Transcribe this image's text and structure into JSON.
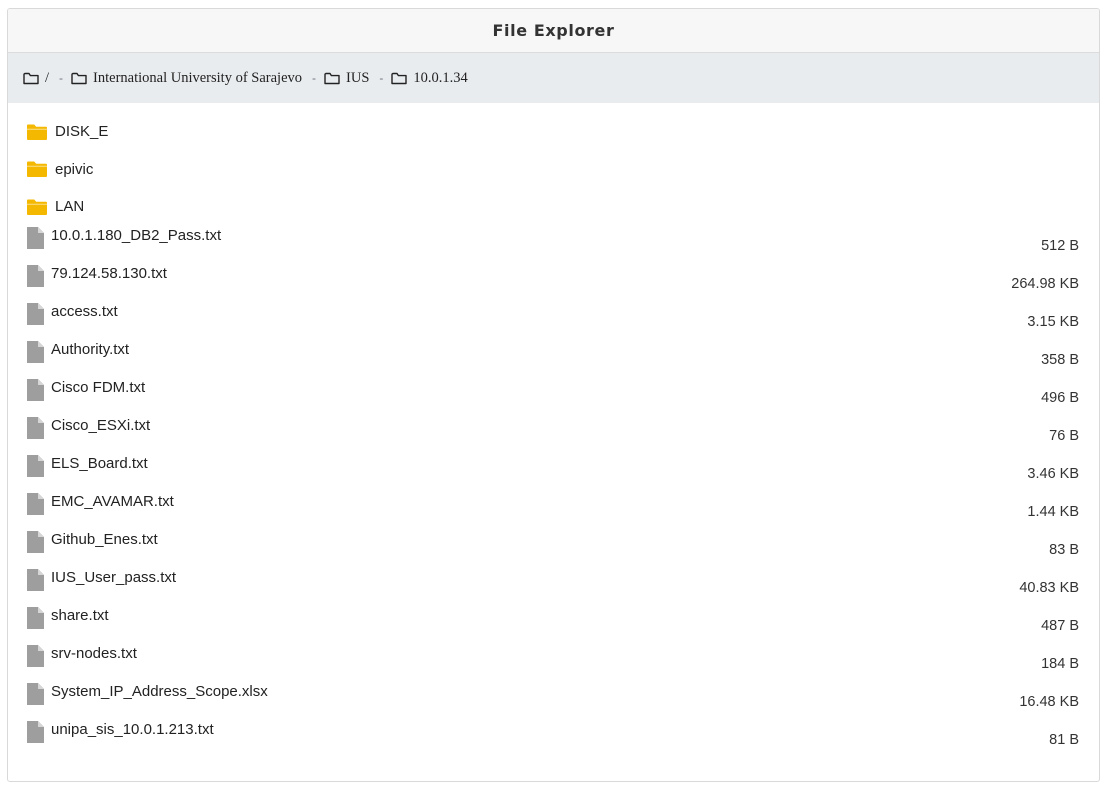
{
  "header": {
    "title": "File Explorer"
  },
  "breadcrumb": [
    {
      "label": "/"
    },
    {
      "label": "International University of Sarajevo"
    },
    {
      "label": "IUS"
    },
    {
      "label": "10.0.1.34"
    }
  ],
  "breadcrumb_separator": "-",
  "folders": [
    {
      "name": "DISK_E"
    },
    {
      "name": "epivic"
    },
    {
      "name": "LAN"
    }
  ],
  "files": [
    {
      "name": "10.0.1.180_DB2_Pass.txt",
      "size": "512 B"
    },
    {
      "name": "79.124.58.130.txt",
      "size": "264.98 KB"
    },
    {
      "name": "access.txt",
      "size": "3.15 KB"
    },
    {
      "name": "Authority.txt",
      "size": "358 B"
    },
    {
      "name": "Cisco FDM.txt",
      "size": "496 B"
    },
    {
      "name": "Cisco_ESXi.txt",
      "size": "76 B"
    },
    {
      "name": "ELS_Board.txt",
      "size": "3.46 KB"
    },
    {
      "name": "EMC_AVAMAR.txt",
      "size": "1.44 KB"
    },
    {
      "name": "Github_Enes.txt",
      "size": "83 B"
    },
    {
      "name": "IUS_User_pass.txt",
      "size": "40.83 KB"
    },
    {
      "name": "share.txt",
      "size": "487 B"
    },
    {
      "name": "srv-nodes.txt",
      "size": "184 B"
    },
    {
      "name": "System_IP_Address_Scope.xlsx",
      "size": "16.48 KB"
    },
    {
      "name": "unipa_sis_10.0.1.213.txt",
      "size": "81 B"
    }
  ],
  "colors": {
    "folder": "#f5b800",
    "file": "#9e9e9e",
    "breadcrumb_bg": "#e9ecef"
  },
  "icons": {
    "breadcrumb": "folder-outline-icon",
    "folder": "folder-icon",
    "file": "file-icon"
  }
}
